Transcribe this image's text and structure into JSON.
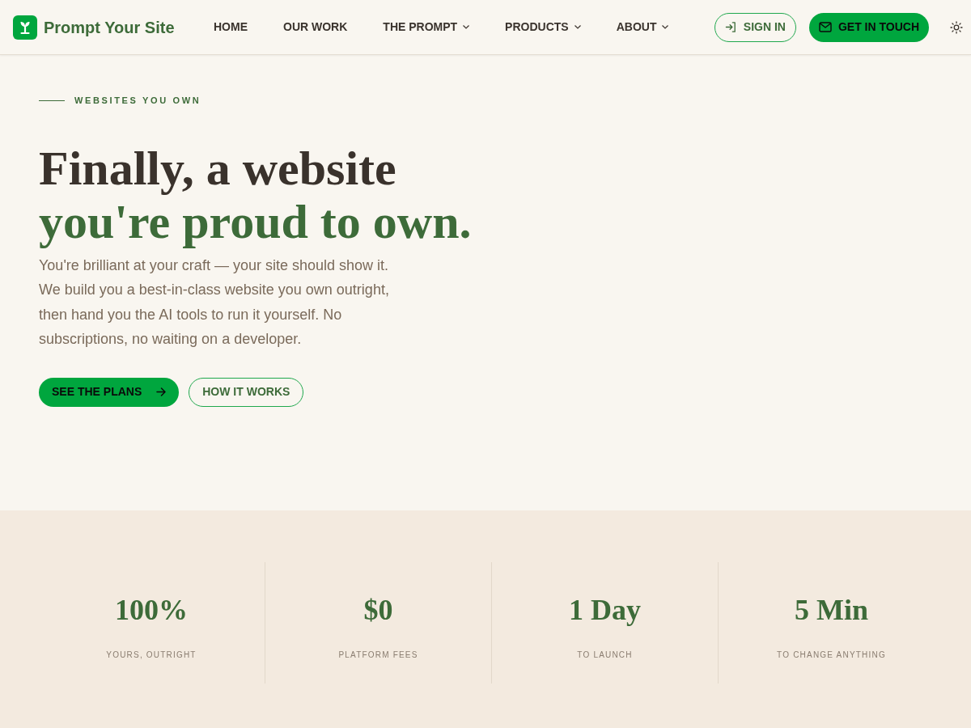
{
  "header": {
    "logo": {
      "text": "Prompt Your Site"
    },
    "nav": [
      {
        "label": "HOME",
        "has_dropdown": false
      },
      {
        "label": "OUR WORK",
        "has_dropdown": false
      },
      {
        "label": "THE PROMPT",
        "has_dropdown": true
      },
      {
        "label": "PRODUCTS",
        "has_dropdown": true
      },
      {
        "label": "ABOUT",
        "has_dropdown": true
      }
    ],
    "actions": [
      {
        "label": "SIGN IN",
        "kind": "outline"
      },
      {
        "label": "GET IN TOUCH",
        "kind": "primary"
      }
    ]
  },
  "hero": {
    "eyebrow": "WEBSITES YOU OWN",
    "title_line_1": "Finally, a website",
    "title_line_2": "you're proud to own.",
    "body": "You're brilliant at your craft — your site should show it. We build you a best-in-class website you own outright, then hand you the AI tools to run it yourself. No subscriptions, no waiting on a developer.",
    "buttons": [
      {
        "label": "SEE THE PLANS",
        "kind": "primary"
      },
      {
        "label": "HOW IT WORKS",
        "kind": "outline"
      }
    ]
  },
  "stats": [
    {
      "value": "100%",
      "label": "YOURS, OUTRIGHT"
    },
    {
      "value": "$0",
      "label": "PLATFORM FEES"
    },
    {
      "value": "1 Day",
      "label": "TO LAUNCH"
    },
    {
      "value": "5 Min",
      "label": "TO CHANGE ANYTHING"
    }
  ]
}
